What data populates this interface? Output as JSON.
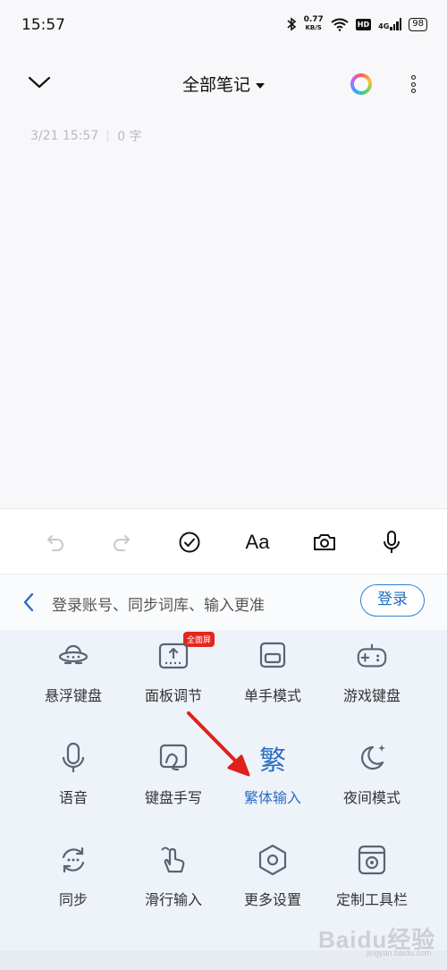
{
  "status_bar": {
    "time": "15:57",
    "net_speed_value": "0.77",
    "net_speed_unit": "KB/S",
    "hd_label": "HD",
    "network_label": "4G",
    "battery": "98"
  },
  "top_bar": {
    "title": "全部笔记"
  },
  "note_meta": {
    "date": "3/21 15:57",
    "word_count": "0 字"
  },
  "toolbar": {
    "font_label": "Aa"
  },
  "login_bar": {
    "prompt": "登录账号、同步词库、输入更准",
    "button": "登录"
  },
  "panel": {
    "badge": "全面屏",
    "items": [
      {
        "label": "悬浮键盘",
        "icon": "ufo-icon"
      },
      {
        "label": "面板调节",
        "icon": "panel-adjust-icon"
      },
      {
        "label": "单手模式",
        "icon": "one-hand-icon"
      },
      {
        "label": "游戏键盘",
        "icon": "gamepad-icon"
      },
      {
        "label": "语音",
        "icon": "microphone-icon"
      },
      {
        "label": "键盘手写",
        "icon": "handwriting-icon"
      },
      {
        "label": "繁体输入",
        "icon": "traditional-char-icon",
        "glyph": "繁"
      },
      {
        "label": "夜间模式",
        "icon": "moon-icon"
      },
      {
        "label": "同步",
        "icon": "sync-icon"
      },
      {
        "label": "滑行输入",
        "icon": "swipe-input-icon"
      },
      {
        "label": "更多设置",
        "icon": "hexagon-settings-icon"
      },
      {
        "label": "定制工具栏",
        "icon": "custom-toolbar-icon"
      }
    ]
  },
  "watermark": {
    "text": "Baidu经验",
    "sub": "jingyan.baidu.com"
  },
  "colors": {
    "accent": "#2c6fbf",
    "annotation_arrow": "#e0201a",
    "badge": "#e6261d"
  }
}
